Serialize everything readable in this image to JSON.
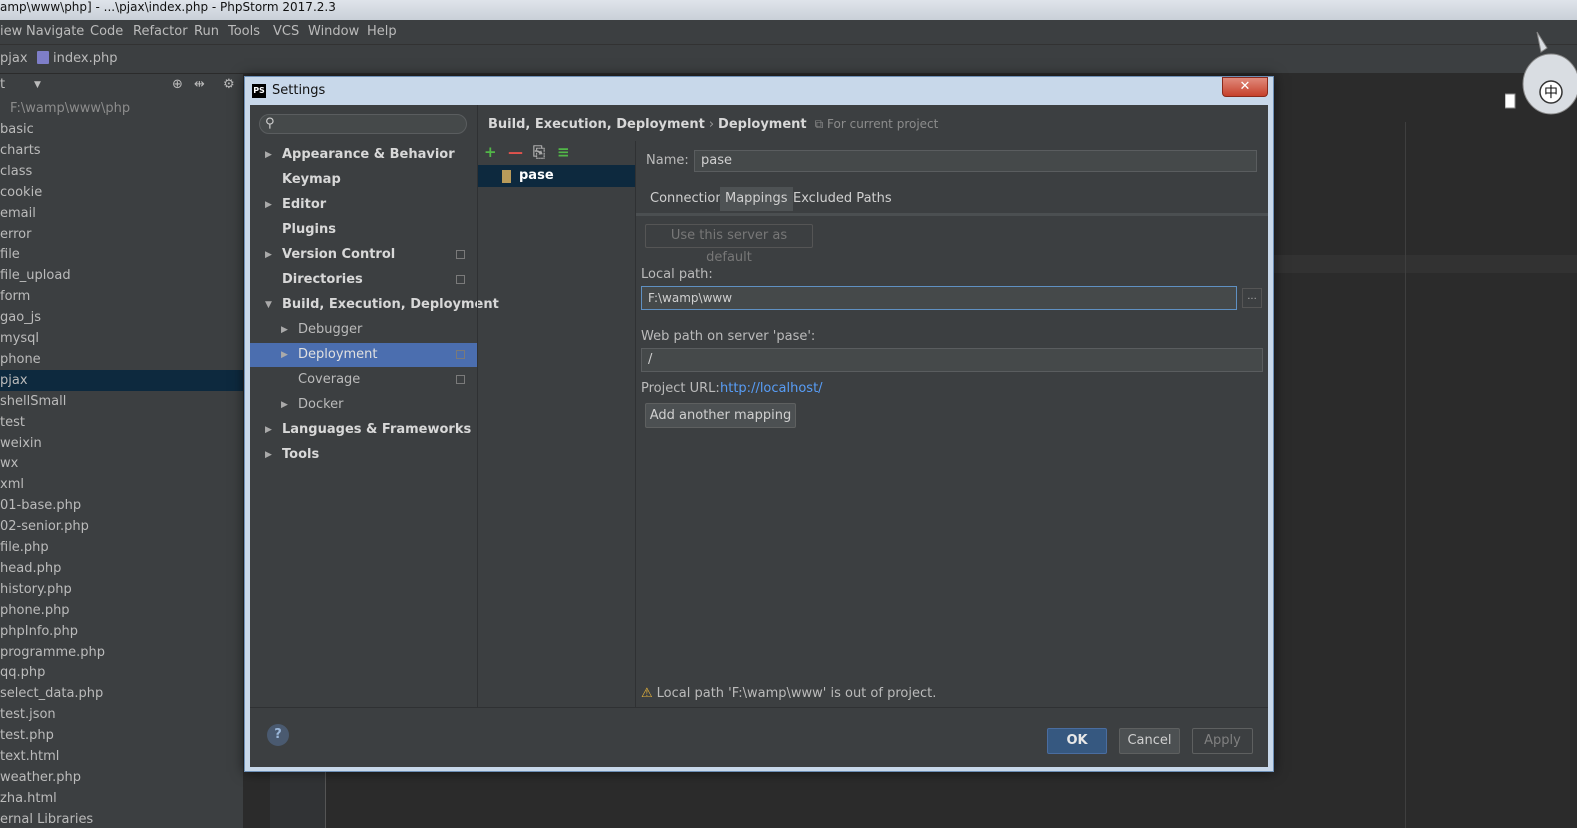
{
  "window": {
    "title": "amp\\www\\php] - ...\\pjax\\index.php - PhpStorm 2017.2.3"
  },
  "menu": [
    "iew",
    "Navigate",
    "Code",
    "Refactor",
    "Run",
    "Tools",
    "VCS",
    "Window",
    "Help"
  ],
  "nav": {
    "project": "pjax",
    "file": "index.php"
  },
  "project_panel": {
    "header": "t",
    "root_path": "F:\\wamp\\www\\php",
    "items": [
      "basic",
      "charts",
      "class",
      "cookie",
      "email",
      "error",
      "file",
      "file_upload",
      "form",
      "gao_js",
      "mysql",
      "phone",
      "pjax",
      "shellSmall",
      "test",
      "weixin",
      "wx",
      "xml",
      "01-base.php",
      "02-senior.php",
      "file.php",
      "head.php",
      "history.php",
      "phone.php",
      "phpInfo.php",
      "programme.php",
      "qq.php",
      "select_data.php",
      "test.json",
      "test.php",
      "text.html",
      "weather.php",
      "zha.html",
      "ernal Libraries"
    ],
    "selected": "pjax"
  },
  "dialog": {
    "title": "Settings",
    "close_glyph": "✕",
    "search_placeholder": "",
    "tree": [
      {
        "label": "Appearance & Behavior",
        "arrow": "▶",
        "bold": true
      },
      {
        "label": "Keymap",
        "arrow": "",
        "bold": true
      },
      {
        "label": "Editor",
        "arrow": "▶",
        "bold": true
      },
      {
        "label": "Plugins",
        "arrow": "",
        "bold": true
      },
      {
        "label": "Version Control",
        "arrow": "▶",
        "bold": true
      },
      {
        "label": "Directories",
        "arrow": "",
        "bold": true
      },
      {
        "label": "Build, Execution, Deployment",
        "arrow": "▼",
        "bold": true
      },
      {
        "label": "Debugger",
        "arrow": "▶",
        "bold": false
      },
      {
        "label": "Deployment",
        "arrow": "▶",
        "bold": false
      },
      {
        "label": "Coverage",
        "arrow": "",
        "bold": false
      },
      {
        "label": "Docker",
        "arrow": "▶",
        "bold": false
      },
      {
        "label": "Languages & Frameworks",
        "arrow": "▶",
        "bold": true
      },
      {
        "label": "Tools",
        "arrow": "▶",
        "bold": true
      }
    ],
    "breadcrumb": {
      "parent": "Build, Execution, Deployment",
      "sep": "›",
      "current": "Deployment",
      "scope": "For current project"
    },
    "toolbar": {
      "add": "+",
      "remove": "—",
      "copy": "⎘",
      "default": "≡"
    },
    "server": {
      "name": "pase"
    },
    "name_label": "Name:",
    "name_value": "pase",
    "tabs": [
      "Connection",
      "Mappings",
      "Excluded Paths"
    ],
    "active_tab": "Mappings",
    "use_default_label": "Use this server as default",
    "local_path_label": "Local path:",
    "local_path_value": "F:\\wamp\\www",
    "browse_label": "...",
    "web_path_label": "Web path on server 'pase':",
    "web_path_value": "/",
    "project_url_label": "Project URL:",
    "project_url_value": "http://localhost/",
    "add_mapping_label": "Add another mapping",
    "warning": "Local path 'F:\\wamp\\www' is out of project.",
    "warning_glyph": "⚠",
    "help_glyph": "?",
    "buttons": {
      "ok": "OK",
      "cancel": "Cancel",
      "apply": "Apply"
    }
  },
  "mascot_glyph": "中"
}
